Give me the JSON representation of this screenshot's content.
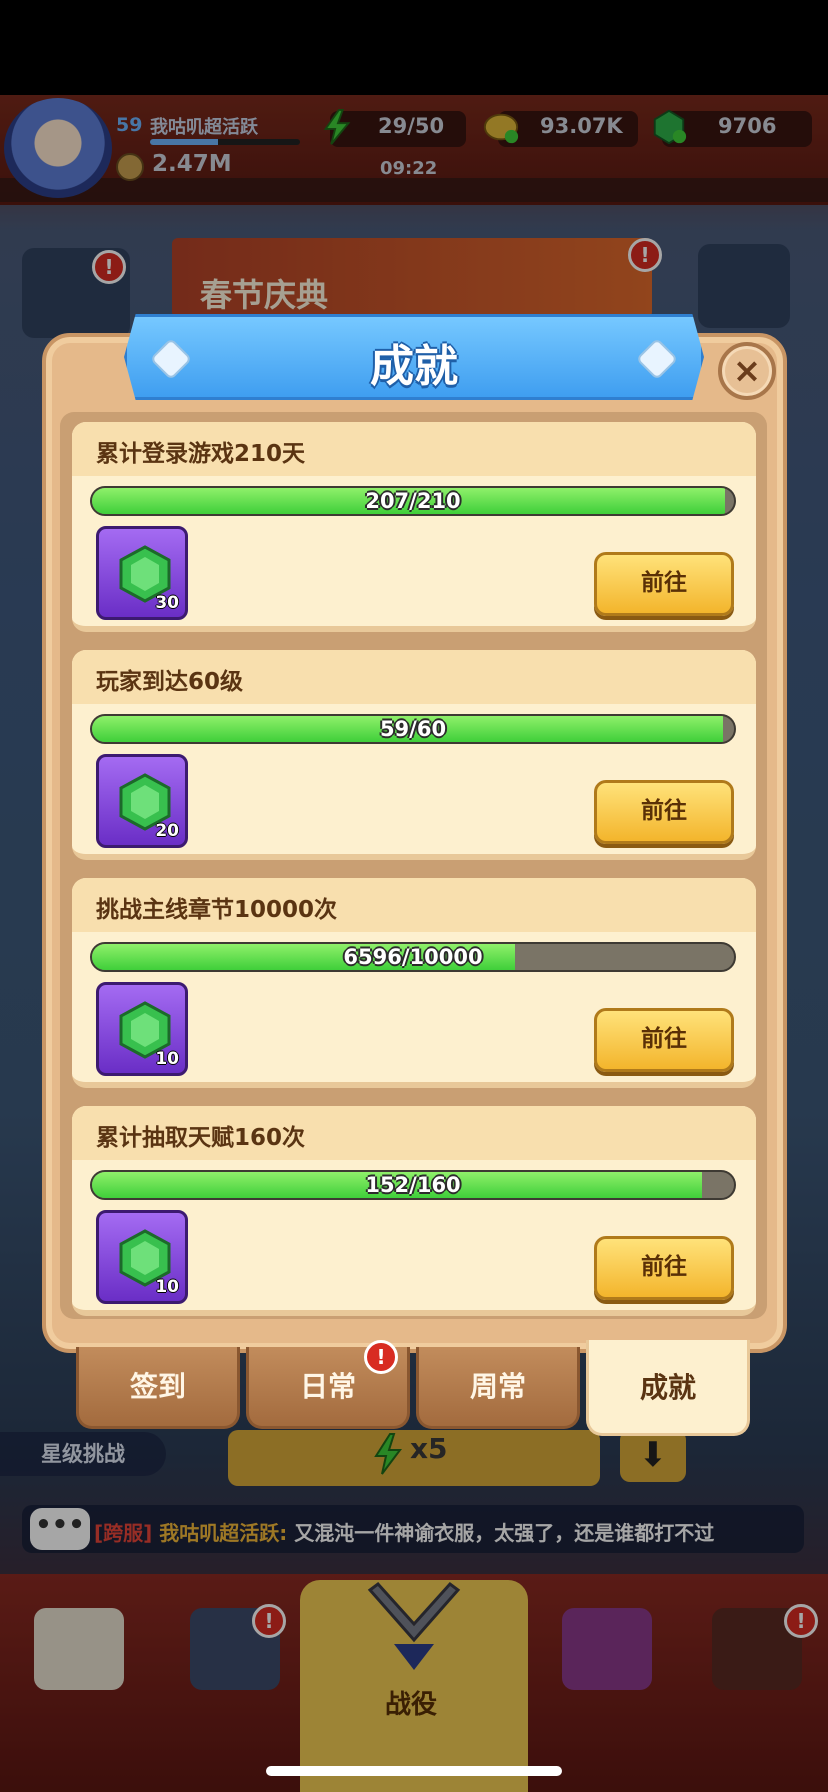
{
  "hud": {
    "level": "59",
    "player_name": "我咕叽超活跃",
    "xp_progress": 0.45,
    "power": "2.47M",
    "energy": "29/50",
    "energy_timer": "09:22",
    "gold": "93.07K",
    "gems": "9706"
  },
  "banner": {
    "title": "春节庆典"
  },
  "dialog": {
    "title": "成就",
    "close_label": "×",
    "achievements": [
      {
        "title": "累计登录游戏210天",
        "progress_text": "207/210",
        "current": 207,
        "target": 210,
        "reward_count": "30",
        "action": "前往"
      },
      {
        "title": "玩家到达60级",
        "progress_text": "59/60",
        "current": 59,
        "target": 60,
        "reward_count": "20",
        "action": "前往"
      },
      {
        "title": "挑战主线章节10000次",
        "progress_text": "6596/10000",
        "current": 6596,
        "target": 10000,
        "reward_count": "10",
        "action": "前往"
      },
      {
        "title": "累计抽取天赋160次",
        "progress_text": "152/160",
        "current": 152,
        "target": 160,
        "reward_count": "10",
        "action": "前往"
      }
    ],
    "tabs": [
      {
        "label": "签到",
        "active": false,
        "badge": false
      },
      {
        "label": "日常",
        "active": false,
        "badge": true
      },
      {
        "label": "周常",
        "active": false,
        "badge": false
      },
      {
        "label": "成就",
        "active": true,
        "badge": false
      }
    ],
    "badge_mark": "!"
  },
  "bottom": {
    "star_challenge": "星级挑战",
    "energy_multiplier": "x5",
    "arrow": "⬇",
    "chat": {
      "icon": "•••",
      "server": "[跨服]",
      "sender": "我咕叽超活跃:",
      "message": " 又混沌一件神谕衣服，太强了，还是谁都打不过"
    },
    "nav_active_label": "战役"
  },
  "colors": {
    "progress_green": "#3fcf3a",
    "title_blue": "#3f9ef0",
    "button_gold": "#f3b52c",
    "alert_red": "#d82c22"
  },
  "icons": [
    "hex-gem-icon",
    "close-icon",
    "alert-icon",
    "lightning-icon",
    "coin-icon",
    "chat-icon",
    "arrow-down-icon",
    "shop-icon",
    "backpack-icon",
    "battle-swords-icon",
    "trophy-icon",
    "scroll-icon"
  ]
}
